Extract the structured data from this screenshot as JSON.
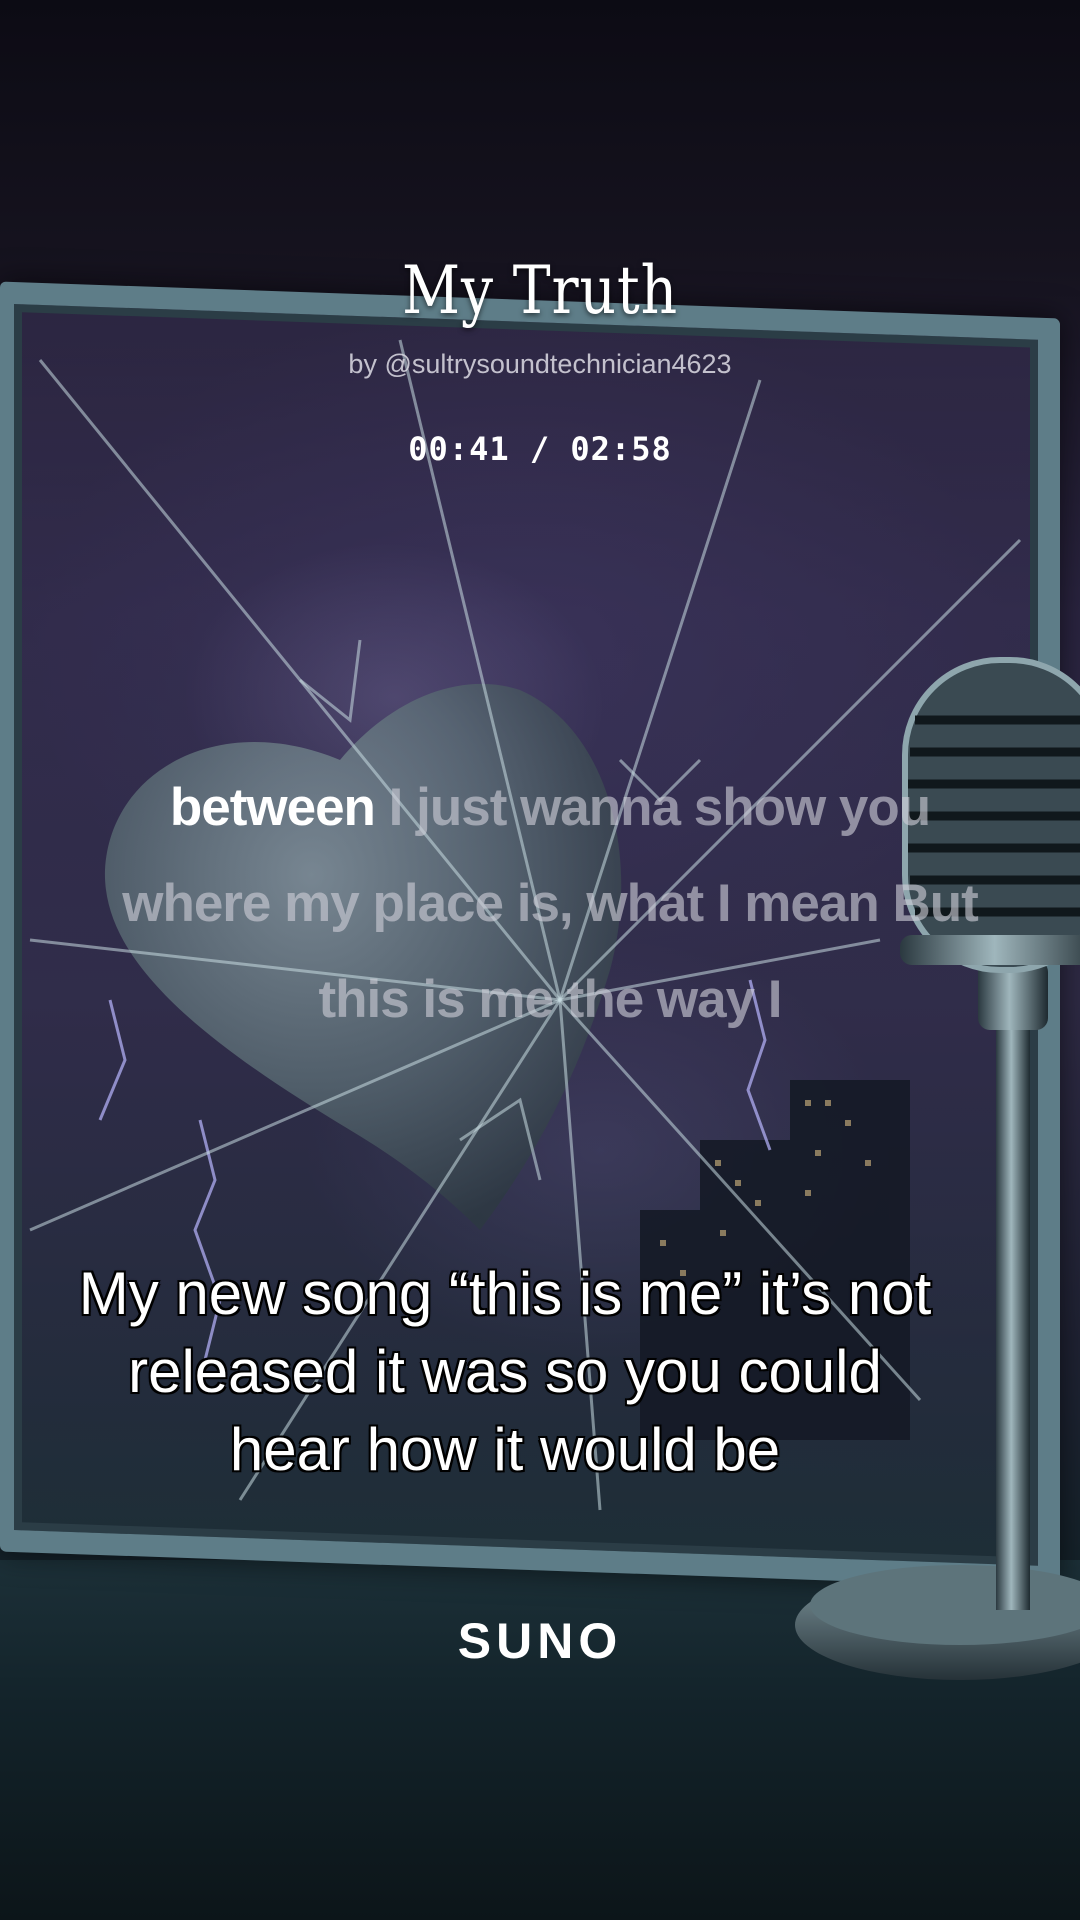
{
  "song": {
    "title": "My Truth",
    "artist_line": "by @sultrysoundtechnician4623",
    "time_display": "00:41 / 02:58"
  },
  "lyrics": {
    "active_word": "between",
    "upcoming": " I just wanna show you where my place is, what I mean But this is me the way I"
  },
  "caption": {
    "text": "My new song “this is me” it’s not released it was so you could hear how it would be"
  },
  "branding": {
    "logo_text": "SUNO"
  },
  "colors": {
    "active_lyric": "#ffffff",
    "inactive_lyric": "#cdcdd7",
    "mirror_frame": "#5e7d88"
  },
  "artwork": {
    "icons": [
      "broken-mirror-art",
      "stone-heart-art",
      "microphone-art",
      "city-skyline-art",
      "lightning-art"
    ]
  }
}
